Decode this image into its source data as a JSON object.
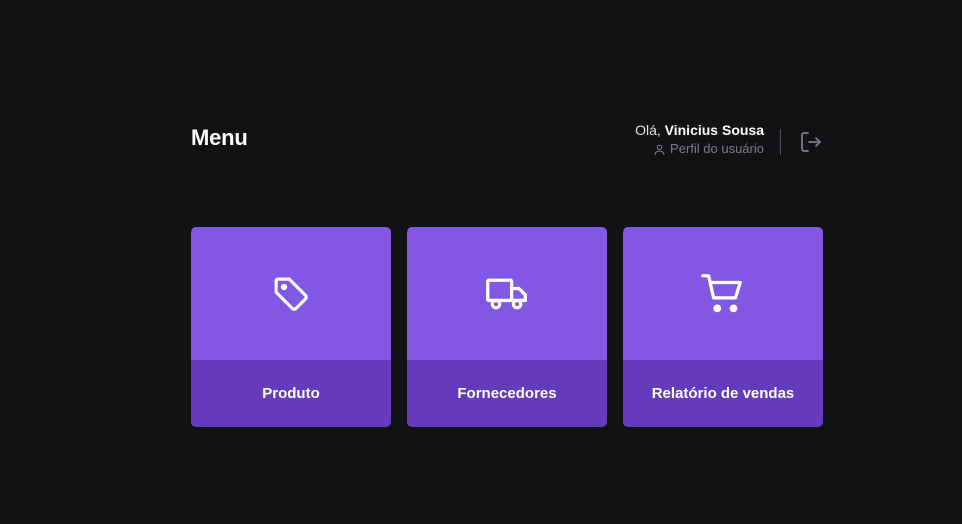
{
  "header": {
    "title": "Menu",
    "greeting_prefix": "Olá, ",
    "user_name": "Vinicius Sousa",
    "profile_label": "Perfil do usuário"
  },
  "cards": [
    {
      "label": "Produto",
      "icon": "tag-icon"
    },
    {
      "label": "Fornecedores",
      "icon": "truck-icon"
    },
    {
      "label": "Relatório de vendas",
      "icon": "shopping-cart-icon"
    }
  ],
  "colors": {
    "background": "#121214",
    "card_top": "#8257e5",
    "card_bottom": "#633bbc",
    "muted_text": "#7c7c8a"
  }
}
